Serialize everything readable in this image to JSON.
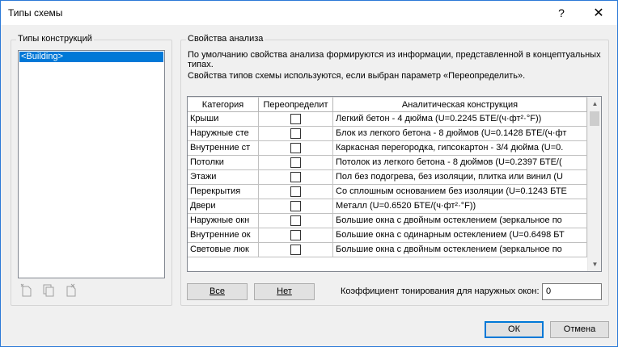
{
  "window": {
    "title": "Типы схемы",
    "help_glyph": "?",
    "close_glyph": "✕"
  },
  "left_group": {
    "label": "Типы конструкций",
    "items": [
      "<Building>"
    ],
    "selected_index": 0
  },
  "right_group": {
    "label": "Свойства анализа",
    "description_line1": "По умолчанию свойства анализа формируются из информации, представленной в концептуальных",
    "description_line2": "типах.",
    "description_line3": "Свойства типов схемы используются, если выбран параметр «Переопределить»."
  },
  "grid": {
    "headers": [
      "Категория",
      "Переопределит",
      "Аналитическая конструкция"
    ],
    "rows": [
      {
        "category": "Крыши",
        "override": false,
        "construction": "Легкий бетон - 4 дюйма (U=0.2245 БТЕ/(ч·фт²·°F))"
      },
      {
        "category": "Наружные сте",
        "override": false,
        "construction": "Блок из легкого бетона - 8 дюймов (U=0.1428 БТЕ/(ч·фт"
      },
      {
        "category": "Внутренние ст",
        "override": false,
        "construction": "Каркасная перегородка, гипсокартон - 3/4 дюйма (U=0."
      },
      {
        "category": "Потолки",
        "override": false,
        "construction": "Потолок из легкого бетона - 8 дюймов (U=0.2397 БТЕ/("
      },
      {
        "category": "Этажи",
        "override": false,
        "construction": "Пол без подогрева, без изоляции, плитка или винил (U"
      },
      {
        "category": "Перекрытия",
        "override": false,
        "construction": "Со сплошным основанием без изоляции (U=0.1243 БТЕ"
      },
      {
        "category": "Двери",
        "override": false,
        "construction": "Металл (U=0.6520 БТЕ/(ч·фт²·°F))"
      },
      {
        "category": "Наружные окн",
        "override": false,
        "construction": "Большие окна с двойным остеклением (зеркальное по"
      },
      {
        "category": "Внутренние ок",
        "override": false,
        "construction": "Большие окна с одинарным остеклением (U=0.6498 БТ"
      },
      {
        "category": "Световые люк",
        "override": false,
        "construction": "Большие окна с двойным остеклением (зеркальное по"
      }
    ]
  },
  "buttons": {
    "all": "Все",
    "none": "Нет",
    "ok": "ОК",
    "cancel": "Отмена"
  },
  "tint": {
    "label": "Коэффициент тонирования для наружных окон:",
    "value": "0"
  },
  "icons": {
    "scroll_up": "▲",
    "scroll_down": "▼"
  }
}
